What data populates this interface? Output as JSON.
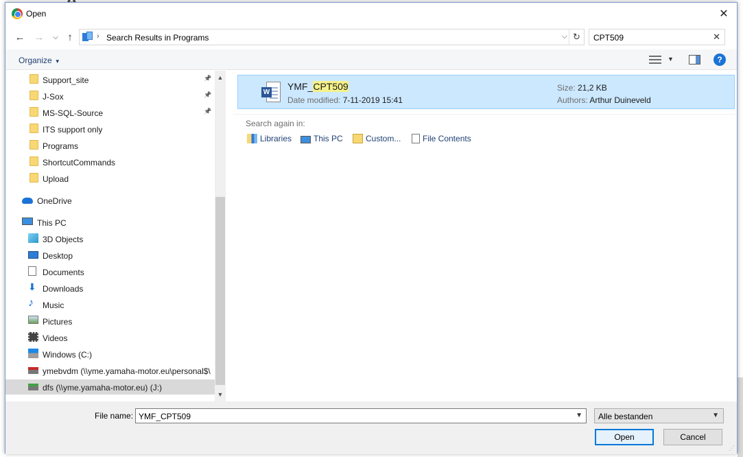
{
  "window": {
    "title": "Open",
    "close": "✕"
  },
  "address": {
    "path": "Search Results in Programs",
    "search_value": "CPT509",
    "clear": "✕",
    "refresh": "↻",
    "dropdown": "⌵"
  },
  "nav_buttons": {
    "back": "←",
    "forward": "→",
    "recent": "⌵",
    "up": "↑"
  },
  "toolbar": {
    "organize": "Organize",
    "help": "?"
  },
  "navigation": {
    "quick_access": [
      {
        "label": "Support_site",
        "pinned": true
      },
      {
        "label": "J-Sox",
        "pinned": true
      },
      {
        "label": "MS-SQL-Source",
        "pinned": true
      },
      {
        "label": "ITS support only",
        "pinned": false
      },
      {
        "label": "Programs",
        "pinned": false
      },
      {
        "label": "ShortcutCommands",
        "pinned": false
      },
      {
        "label": "Upload",
        "pinned": false
      }
    ],
    "onedrive": "OneDrive",
    "this_pc": "This PC",
    "pc_items": [
      {
        "label": "3D Objects",
        "icon": "3d-objects-icon"
      },
      {
        "label": "Desktop",
        "icon": "desktop-icon"
      },
      {
        "label": "Documents",
        "icon": "documents-icon"
      },
      {
        "label": "Downloads",
        "icon": "downloads-icon"
      },
      {
        "label": "Music",
        "icon": "music-icon"
      },
      {
        "label": "Pictures",
        "icon": "pictures-icon"
      },
      {
        "label": "Videos",
        "icon": "videos-icon"
      },
      {
        "label": "Windows (C:)",
        "icon": "windows-drive-icon"
      },
      {
        "label": "ymebvdm (\\\\yme.yamaha-motor.eu\\personal$\\",
        "icon": "network-drive-disconnected-icon"
      },
      {
        "label": "dfs (\\\\yme.yamaha-motor.eu) (J:)",
        "icon": "network-drive-icon"
      }
    ],
    "selected": "dfs (\\\\yme.yamaha-motor.eu) (J:)"
  },
  "result": {
    "name_prefix": "YMF_",
    "name_highlight": "CPT509",
    "date_label": "Date modified:",
    "date_value": "7-11-2019 15:41",
    "size_label": "Size:",
    "size_value": "21,2 KB",
    "authors_label": "Authors:",
    "authors_value": "Arthur Duineveld",
    "icon_letter": "W"
  },
  "search_again": {
    "title": "Search again in:",
    "links": [
      "Libraries",
      "This PC",
      "Custom...",
      "File Contents"
    ]
  },
  "footer": {
    "file_name_label": "File name:",
    "file_name_value": "YMF_CPT509",
    "file_type": "Alle bestanden",
    "open": "Open",
    "cancel": "Cancel"
  },
  "colors": {
    "selection": "#cce8ff",
    "highlight": "#f5f28a",
    "accent": "#0078d7",
    "link": "#1e3f73"
  }
}
